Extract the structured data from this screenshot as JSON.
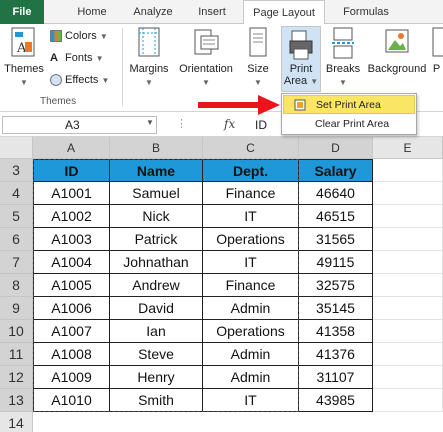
{
  "tabs": [
    "File",
    "Home",
    "Analyze",
    "Insert",
    "Page Layout",
    "Formulas"
  ],
  "active_tab": "Page Layout",
  "ribbon": {
    "themes_label": "Themes",
    "colors_label": "Colors",
    "fonts_label": "Fonts",
    "effects_label": "Effects",
    "group_themes": "Themes",
    "margins_label": "Margins",
    "orientation_label": "Orientation",
    "size_label": "Size",
    "print_area_label_1": "Print",
    "print_area_label_2": "Area",
    "breaks_label": "Breaks",
    "background_label": "Background",
    "print_titles_label": "P"
  },
  "print_area_menu": {
    "set": "Set Print Area",
    "clear": "Clear Print Area"
  },
  "formula_bar": {
    "name_box": "A3",
    "fx": "fx",
    "value": "ID"
  },
  "columns": [
    "A",
    "B",
    "C",
    "D",
    "E"
  ],
  "rows": [
    "3",
    "4",
    "5",
    "6",
    "7",
    "8",
    "9",
    "10",
    "11",
    "12",
    "13",
    "14"
  ],
  "table": {
    "headers": [
      "ID",
      "Name",
      "Dept.",
      "Salary"
    ],
    "data": [
      [
        "A1001",
        "Samuel",
        "Finance",
        "46640"
      ],
      [
        "A1002",
        "Nick",
        "IT",
        "46515"
      ],
      [
        "A1003",
        "Patrick",
        "Operations",
        "31565"
      ],
      [
        "A1004",
        "Johnathan",
        "IT",
        "49115"
      ],
      [
        "A1005",
        "Andrew",
        "Finance",
        "32575"
      ],
      [
        "A1006",
        "David",
        "Admin",
        "35145"
      ],
      [
        "A1007",
        "Ian",
        "Operations",
        "41358"
      ],
      [
        "A1008",
        "Steve",
        "Admin",
        "41376"
      ],
      [
        "A1009",
        "Henry",
        "Admin",
        "31107"
      ],
      [
        "A1010",
        "Smith",
        "IT",
        "43985"
      ]
    ]
  },
  "colors": {
    "file_tab": "#217346",
    "header_fill": "#1e98d8",
    "menu_highlight": "#fbe564",
    "arrow": "#e8161b"
  }
}
